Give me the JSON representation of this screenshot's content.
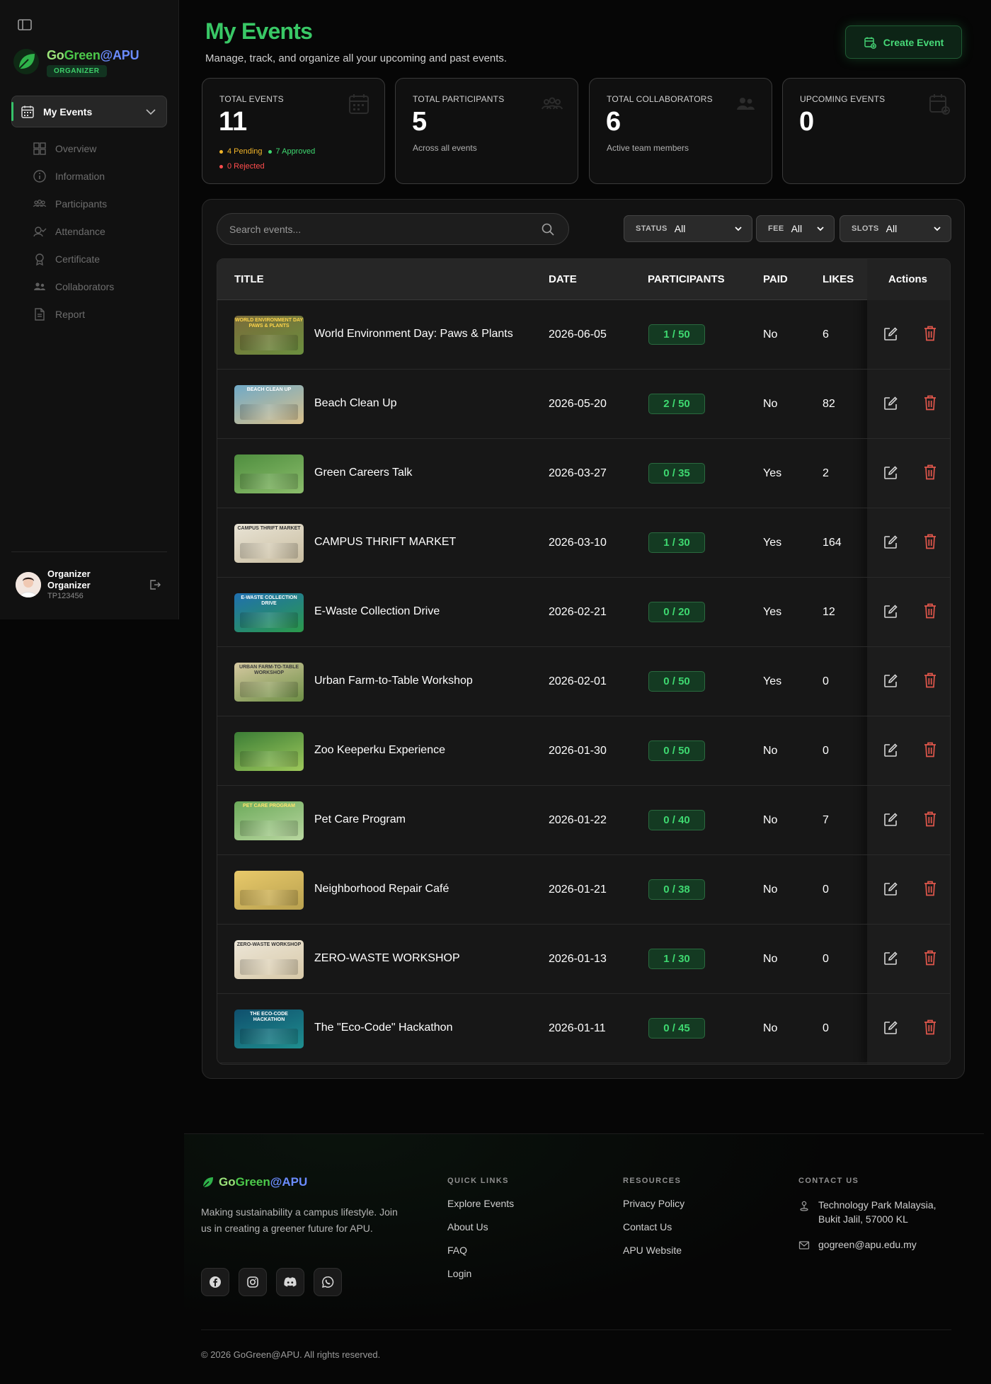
{
  "sidebar": {
    "brand": {
      "go": "Go",
      "green": "Green",
      "apu": "@APU",
      "badge": "ORGANIZER"
    },
    "main_nav_label": "My Events",
    "items": [
      {
        "label": "Overview",
        "icon": "grid-icon"
      },
      {
        "label": "Information",
        "icon": "info-icon"
      },
      {
        "label": "Participants",
        "icon": "users-icon"
      },
      {
        "label": "Attendance",
        "icon": "attendance-icon"
      },
      {
        "label": "Certificate",
        "icon": "award-icon"
      },
      {
        "label": "Collaborators",
        "icon": "collaborators-icon"
      },
      {
        "label": "Report",
        "icon": "report-icon"
      }
    ],
    "user": {
      "name": "Organizer Organizer",
      "id": "TP123456"
    }
  },
  "header": {
    "title": "My Events",
    "subtitle": "Manage, track, and organize all your upcoming and past events.",
    "create_label": "Create Event"
  },
  "stats": [
    {
      "label": "TOTAL EVENTS",
      "value": "11",
      "icon": "calendar-icon"
    },
    {
      "label": "TOTAL PARTICIPANTS",
      "value": "5",
      "sub": "Across all events",
      "icon": "users-icon"
    },
    {
      "label": "TOTAL COLLABORATORS",
      "value": "6",
      "sub": "Active team members",
      "icon": "collaborators-icon"
    },
    {
      "label": "UPCOMING EVENTS",
      "value": "0",
      "icon": "calendar-plus-icon"
    }
  ],
  "status_pills": {
    "pending": "4 Pending",
    "approved": "7 Approved",
    "rejected": "0 Rejected"
  },
  "colors": {
    "accent": "#39c866",
    "pending": "#f0b429",
    "approved": "#3ed870",
    "rejected": "#ff4d4d",
    "delete": "#e2574c"
  },
  "filters": {
    "search_placeholder": "Search events...",
    "status": {
      "label": "STATUS",
      "value": "All"
    },
    "fee": {
      "label": "FEE",
      "value": "All"
    },
    "slots": {
      "label": "SLOTS",
      "value": "All"
    }
  },
  "table": {
    "headers": {
      "title": "TITLE",
      "date": "DATE",
      "participants": "PARTICIPANTS",
      "paid": "PAID",
      "likes": "LIKES",
      "actions": "Actions"
    },
    "rows": [
      {
        "title": "World Environment Day: Paws & Plants",
        "date": "2026-06-05",
        "participants": "1 / 50",
        "paid": "No",
        "likes": "6",
        "thumb_label": "WORLD ENVIRONMENT DAY PAWS & PLANTS"
      },
      {
        "title": "Beach Clean Up",
        "date": "2026-05-20",
        "participants": "2 / 50",
        "paid": "No",
        "likes": "82",
        "thumb_label": "BEACH CLEAN UP"
      },
      {
        "title": "Green Careers Talk",
        "date": "2026-03-27",
        "participants": "0 / 35",
        "paid": "Yes",
        "likes": "2",
        "thumb_label": ""
      },
      {
        "title": "CAMPUS THRIFT MARKET",
        "date": "2026-03-10",
        "participants": "1 / 30",
        "paid": "Yes",
        "likes": "164",
        "thumb_label": "CAMPUS THRIFT MARKET"
      },
      {
        "title": "E-Waste Collection Drive",
        "date": "2026-02-21",
        "participants": "0 / 20",
        "paid": "Yes",
        "likes": "12",
        "thumb_label": "E-WASTE COLLECTION DRIVE"
      },
      {
        "title": "Urban Farm-to-Table Workshop",
        "date": "2026-02-01",
        "participants": "0 / 50",
        "paid": "Yes",
        "likes": "0",
        "thumb_label": "URBAN FARM-TO-TABLE WORKSHOP"
      },
      {
        "title": "Zoo Keeperku Experience",
        "date": "2026-01-30",
        "participants": "0 / 50",
        "paid": "No",
        "likes": "0",
        "thumb_label": ""
      },
      {
        "title": "Pet Care Program",
        "date": "2026-01-22",
        "participants": "0 / 40",
        "paid": "No",
        "likes": "7",
        "thumb_label": "PET CARE PROGRAM"
      },
      {
        "title": "Neighborhood Repair Café",
        "date": "2026-01-21",
        "participants": "0 / 38",
        "paid": "No",
        "likes": "0",
        "thumb_label": ""
      },
      {
        "title": "ZERO-WASTE WORKSHOP",
        "date": "2026-01-13",
        "participants": "1 / 30",
        "paid": "No",
        "likes": "0",
        "thumb_label": "ZERO-WASTE WORKSHOP"
      },
      {
        "title": "The \"Eco-Code\" Hackathon",
        "date": "2026-01-11",
        "participants": "0 / 45",
        "paid": "No",
        "likes": "0",
        "thumb_label": "THE ECO-CODE HACKATHON"
      }
    ]
  },
  "footer": {
    "brand": {
      "go": "Go",
      "green": "Green",
      "apu": "@APU"
    },
    "description": "Making sustainability a campus lifestyle. Join us in creating a greener future for APU.",
    "quick_links": {
      "heading": "QUICK LINKS",
      "links": [
        "Explore Events",
        "About Us",
        "FAQ",
        "Login"
      ]
    },
    "resources": {
      "heading": "RESOURCES",
      "links": [
        "Privacy Policy",
        "Contact Us",
        "APU Website"
      ]
    },
    "contact": {
      "heading": "CONTACT US",
      "address": "Technology Park Malaysia, Bukit Jalil, 57000 KL",
      "email": "gogreen@apu.edu.my"
    },
    "socials": [
      "facebook-icon",
      "instagram-icon",
      "discord-icon",
      "whatsapp-icon"
    ],
    "copyright": "© 2026 GoGreen@APU. All rights reserved."
  }
}
